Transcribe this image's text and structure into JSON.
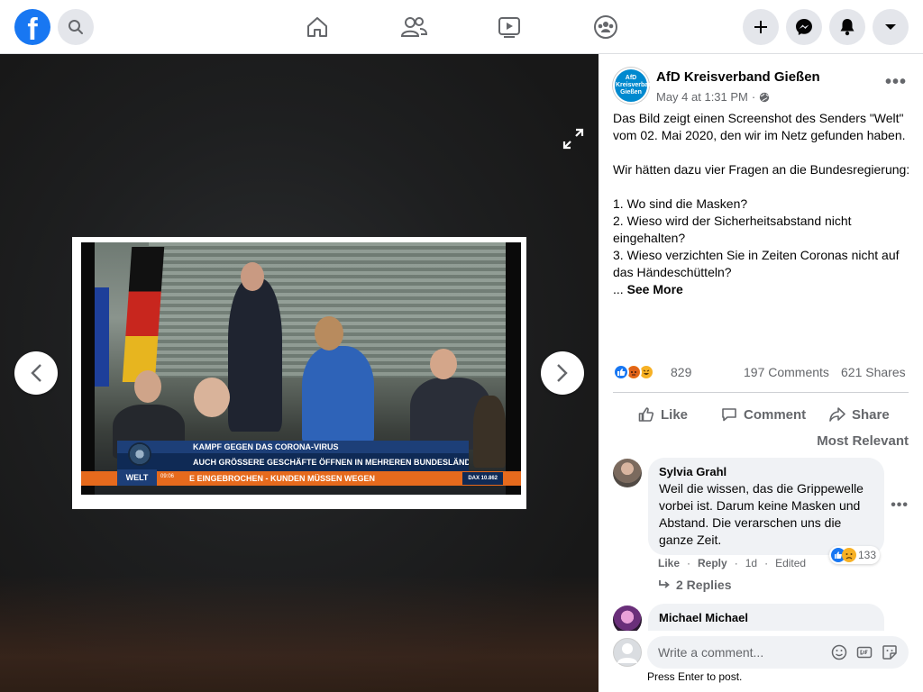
{
  "colors": {
    "brand": "#1877f2",
    "icon_gray": "#65676b",
    "bubble_bg": "#f0f2f5",
    "viewer_bg": "#1e1f20"
  },
  "topbar": {
    "logo_letter": "f",
    "nav_icons": [
      "home-icon",
      "friends-icon",
      "watch-icon",
      "groups-icon"
    ],
    "right_icons": [
      "plus-icon",
      "messenger-icon",
      "bell-icon",
      "caret-down-icon"
    ]
  },
  "photo": {
    "overlay": {
      "headline": "KAMPF GEGEN DAS CORONA-VIRUS",
      "subline": "AUCH GRÖSSERE GESCHÄFTE ÖFFNEN IN MEHREREN BUNDESLÄNDERN",
      "ticker": "E EINGEBROCHEN - KUNDEN MÜSSEN WEGEN",
      "channel": "WELT",
      "time": "09:06",
      "dax": "DAX 10.862"
    }
  },
  "post": {
    "author": "AfD Kreisverband Gießen",
    "avatar_text": "AfD Kreisverband Gießen",
    "date": "May 4 at 1:31 PM",
    "separator": "·",
    "privacy_icon": "globe-icon",
    "text": "Das Bild zeigt einen Screenshot des Senders \"Welt\" vom 02. Mai 2020, den wir im Netz gefunden haben.\n\nWir hätten dazu vier Fragen an die Bundesregierung:\n\n1. Wo sind die Masken?\n2. Wieso wird der Sicherheitsabstand nicht eingehalten?\n3. Wieso verzichten Sie in Zeiten Coronas nicht auf das Händeschütteln?\n... ",
    "see_more": "See More",
    "reaction_count": "829",
    "comments_count": "197 Comments",
    "shares_count": "621 Shares",
    "actions": {
      "like": "Like",
      "comment": "Comment",
      "share": "Share"
    },
    "sort_label": "Most Relevant"
  },
  "comments": [
    {
      "name": "Sylvia Grahl",
      "text": "Weil die wissen, das die Grippewelle vorbei ist. Darum keine Masken und Abstand. Die verarschen uns die ganze Zeit.",
      "like": "Like",
      "reply": "Reply",
      "time": "1d",
      "edited": "Edited",
      "reaction_count": "133",
      "replies": "2 Replies"
    },
    {
      "name": "Michael Michael"
    }
  ],
  "compose": {
    "placeholder": "Write a comment...",
    "hint": "Press Enter to post."
  }
}
